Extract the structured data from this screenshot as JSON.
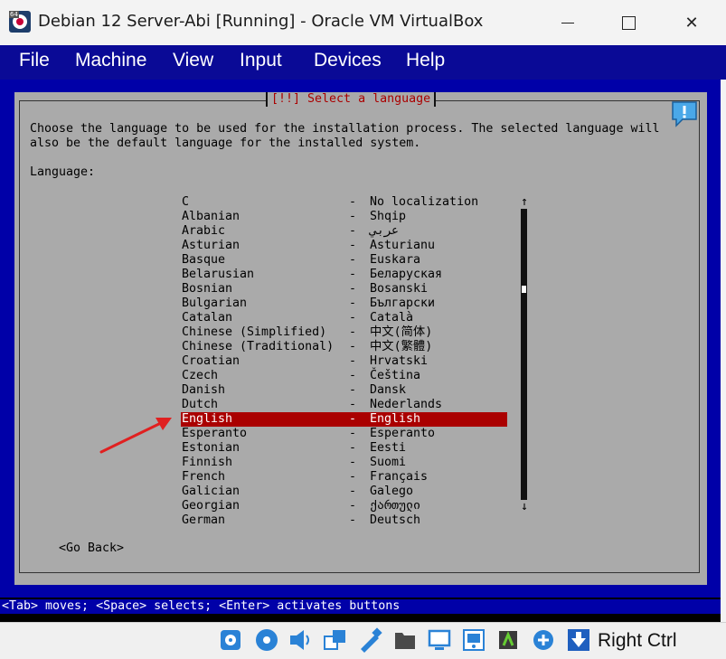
{
  "window": {
    "title": "Debian 12 Server-Abi [Running] - Oracle VM VirtualBox",
    "icon_tag": "64",
    "minimize_icon": "minimize-icon",
    "maximize_icon": "maximize-icon",
    "close_icon": "close-icon",
    "close_glyph": "✕"
  },
  "menubar": {
    "items": [
      "File",
      "Machine",
      "View",
      "Input",
      "Devices",
      "Help"
    ]
  },
  "installer": {
    "title": "[!!] Select a language",
    "description": "Choose the language to be used for the installation process. The selected language will\nalso be the default language for the installed system.",
    "language_label": "Language:",
    "languages": [
      {
        "name": "C",
        "native": "No localization"
      },
      {
        "name": "Albanian",
        "native": "Shqip"
      },
      {
        "name": "Arabic",
        "native": "عربي"
      },
      {
        "name": "Asturian",
        "native": "Asturianu"
      },
      {
        "name": "Basque",
        "native": "Euskara"
      },
      {
        "name": "Belarusian",
        "native": "Беларуская"
      },
      {
        "name": "Bosnian",
        "native": "Bosanski"
      },
      {
        "name": "Bulgarian",
        "native": "Български"
      },
      {
        "name": "Catalan",
        "native": "Català"
      },
      {
        "name": "Chinese (Simplified)",
        "native": "中文(简体)"
      },
      {
        "name": "Chinese (Traditional)",
        "native": "中文(繁體)"
      },
      {
        "name": "Croatian",
        "native": "Hrvatski"
      },
      {
        "name": "Czech",
        "native": "Čeština"
      },
      {
        "name": "Danish",
        "native": "Dansk"
      },
      {
        "name": "Dutch",
        "native": "Nederlands"
      },
      {
        "name": "English",
        "native": "English",
        "selected": true
      },
      {
        "name": "Esperanto",
        "native": "Esperanto"
      },
      {
        "name": "Estonian",
        "native": "Eesti"
      },
      {
        "name": "Finnish",
        "native": "Suomi"
      },
      {
        "name": "French",
        "native": "Français"
      },
      {
        "name": "Galician",
        "native": "Galego"
      },
      {
        "name": "Georgian",
        "native": "ქართული"
      },
      {
        "name": "German",
        "native": "Deutsch"
      }
    ],
    "separator": "-",
    "scroll_up": "↑",
    "scroll_down": "↓",
    "go_back": "<Go Back>",
    "help_text": "<Tab> moves; <Space> selects; <Enter> activates buttons"
  },
  "colors": {
    "menubar_bg": "#0a0a96",
    "installer_bg": "#0000a8",
    "dialog_bg": "#aaaaaa",
    "selection": "#aa0000",
    "title_text": "#aa0000",
    "annotation_arrow": "#e02020"
  },
  "statusbar": {
    "icons": [
      "hard-disk-icon",
      "optical-disk-icon",
      "audio-icon",
      "network-icon",
      "usb-icon",
      "shared-folders-icon",
      "display-icon",
      "video-capture-icon",
      "cpu-icon",
      "guest-additions-icon",
      "host-key-arrow-icon"
    ],
    "host_key": "Right Ctrl"
  }
}
